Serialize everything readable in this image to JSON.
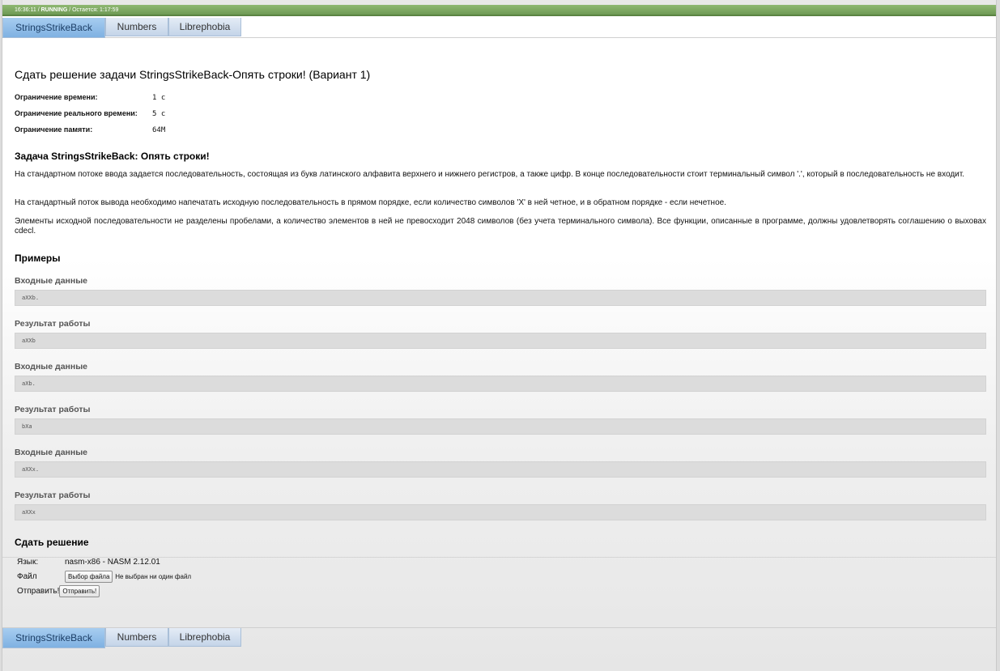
{
  "status": {
    "time": "16:36:11",
    "separator": "/",
    "state": "RUNNING",
    "remaining": "/ Остается: 1:17:59"
  },
  "tabs": [
    "StringsStrikeBack",
    "Numbers",
    "Librephobia"
  ],
  "page_title": "Сдать решение задачи StringsStrikeBack-Опять строки! (Вариант 1)",
  "limits": [
    {
      "label": "Ограничение времени:",
      "value": "1 с"
    },
    {
      "label": "Ограничение реального времени:",
      "value": "5 с"
    },
    {
      "label": "Ограничение памяти:",
      "value": "64M"
    }
  ],
  "task_title": "Задача StringsStrikeBack: Опять строки!",
  "paragraphs": [
    "На стандартном потоке ввода задается последовательность, состоящая из букв латинского алфавита верхнего и нижнего регистров, а также цифр. В конце последовательности стоит терминальный символ '.', который в последовательность не входит.",
    "На стандартный поток вывода необходимо напечатать исходную последовательность в прямом порядке, если количество символов 'X' в ней четное, и в обратном порядке - если нечетное.",
    "Элементы исходной последовательности не разделены пробелами, а количество элементов в ней не превосходит 2048 символов (без учета терминального символа). Все функции, описанные в программе, должны удовлетворять соглашению о выховах cdecl."
  ],
  "examples_title": "Примеры",
  "examples": [
    {
      "label": "Входные данные",
      "value": "aXXb."
    },
    {
      "label": "Результат работы",
      "value": "aXXb"
    },
    {
      "label": "Входные данные",
      "value": "aXb."
    },
    {
      "label": "Результат работы",
      "value": "bXa"
    },
    {
      "label": "Входные данные",
      "value": "aXXx."
    },
    {
      "label": "Результат работы",
      "value": "aXXx"
    }
  ],
  "submit": {
    "title": "Сдать решение",
    "lang_label": "Язык:",
    "lang_value": "nasm-x86 - NASM 2.12.01",
    "file_label": "Файл",
    "file_button": "Выбор файла",
    "file_hint": "Не выбран ни один файл",
    "send_label": "Отправить!",
    "send_button": "Отправить!"
  }
}
